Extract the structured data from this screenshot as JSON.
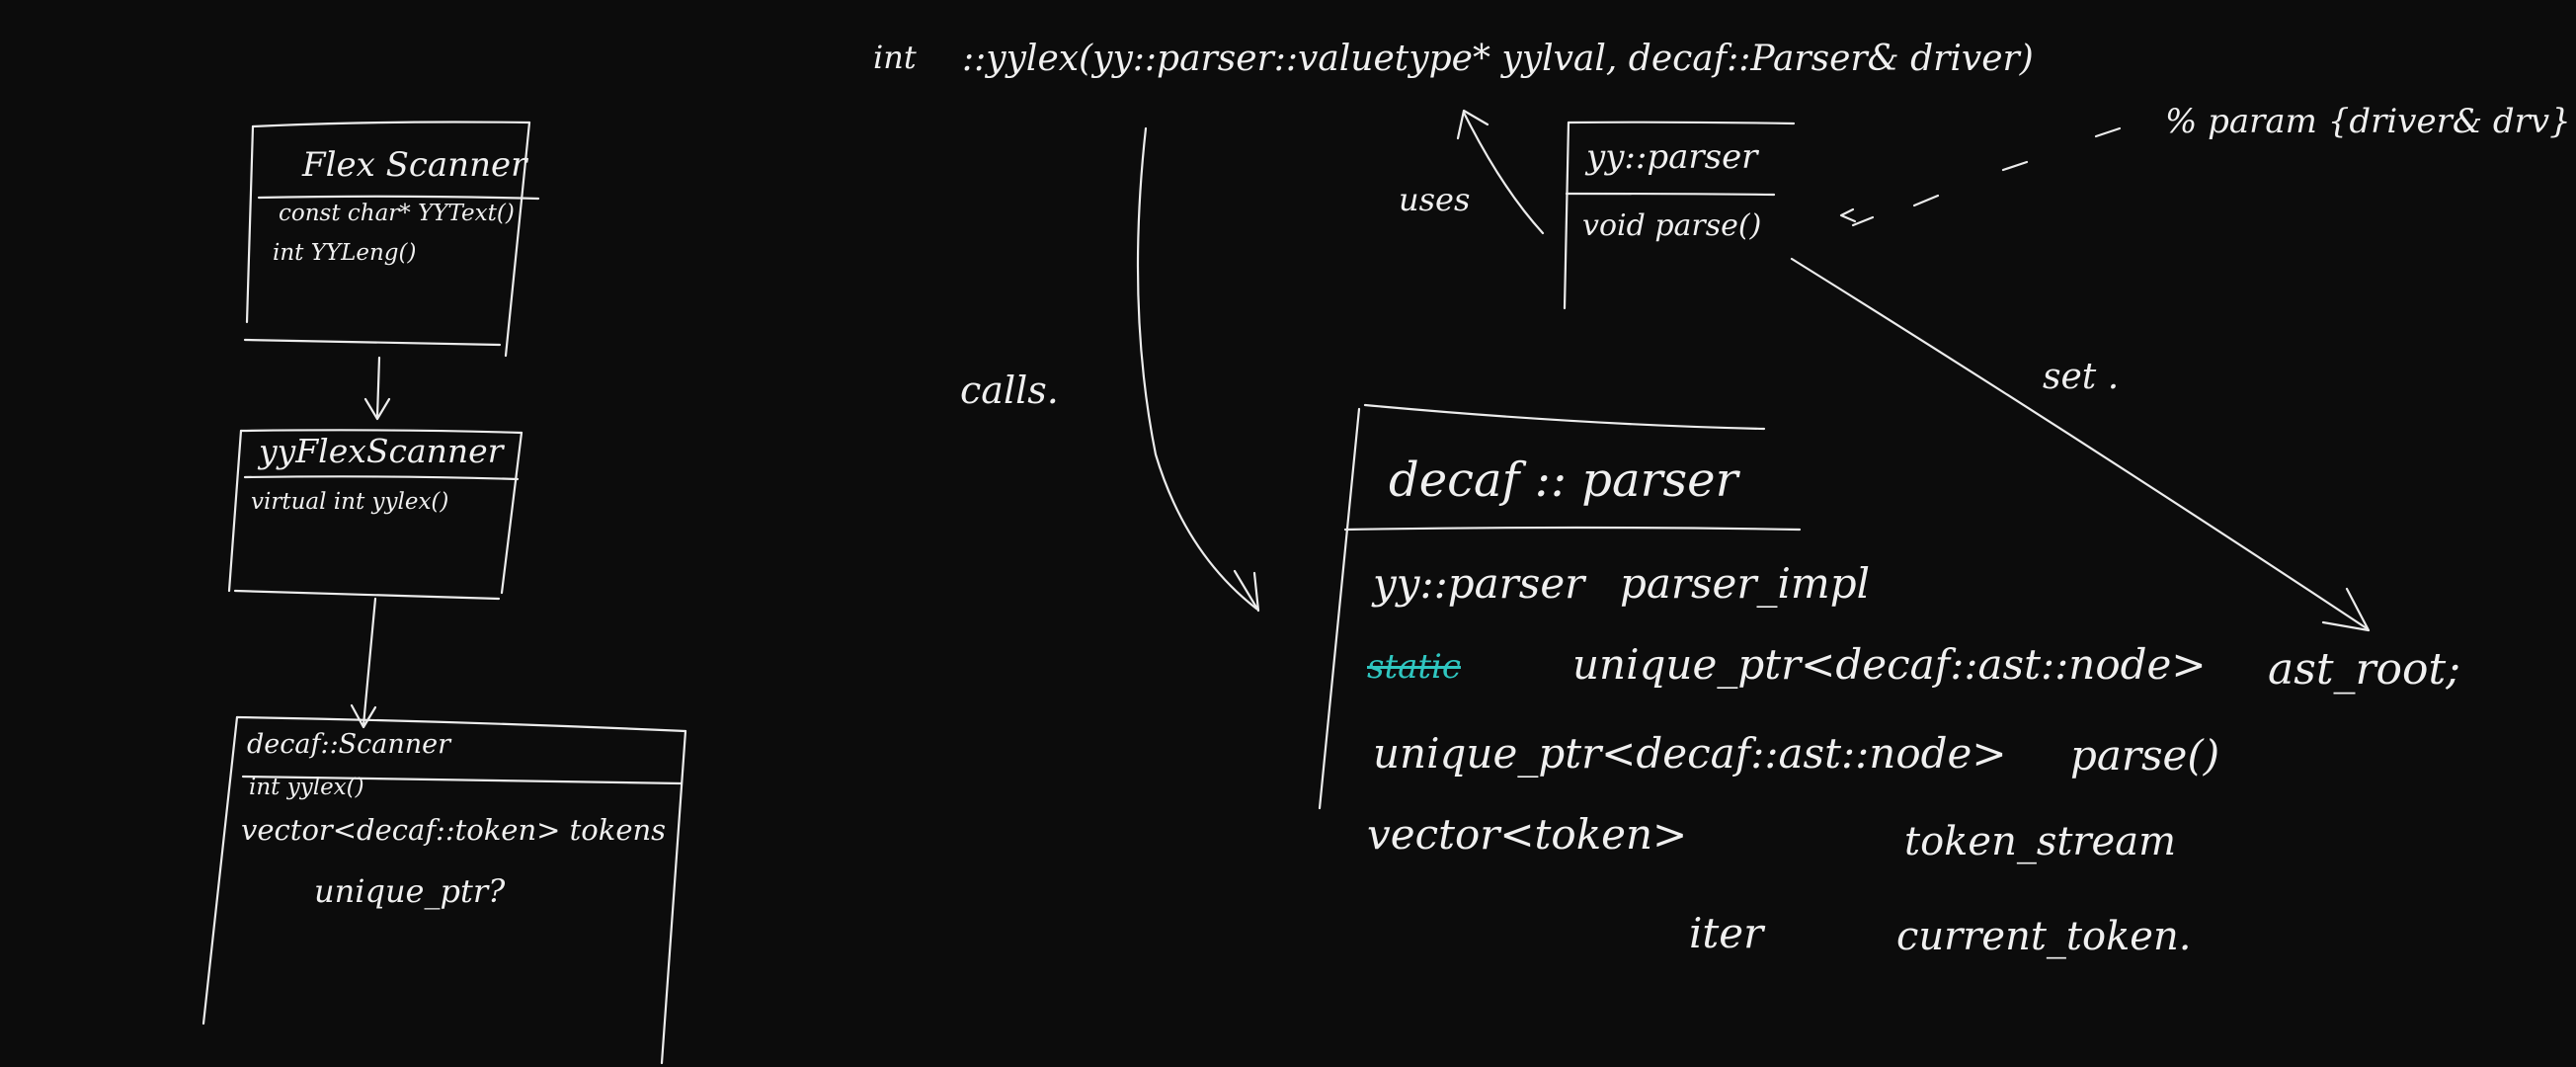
{
  "colors": {
    "background": "#0c0c0c",
    "ink": "#ececec",
    "highlight": "#2fc6c0"
  },
  "signature": {
    "ret": "int",
    "text": "::yylex(yy::parser::valuetype* yylval, decaf::Parser& driver)"
  },
  "flex_scanner": {
    "title": "Flex Scanner",
    "members": [
      "const char* YYText()",
      "int YYLeng()"
    ]
  },
  "yy_flex_scanner": {
    "title": "yyFlexScanner",
    "members": [
      "virtual int yylex()"
    ]
  },
  "decaf_scanner": {
    "title": "decaf::Scanner",
    "members": [
      "int yylex()",
      "vector<decaf::token>  tokens",
      "unique_ptr?"
    ]
  },
  "yy_parser": {
    "title": "yy::parser",
    "members": [
      "void parse()"
    ]
  },
  "param_note": "% param {driver& drv}",
  "labels": {
    "uses": "uses",
    "calls": "calls.",
    "set": "set ."
  },
  "decaf_parser": {
    "title": "decaf :: parser",
    "rows": [
      {
        "type": "yy::parser",
        "name": "parser_impl"
      },
      {
        "modifier": "static",
        "type": "unique_ptr<decaf::ast::node>",
        "name": "ast_root;"
      },
      {
        "type": "unique_ptr<decaf::ast::node>",
        "name": "parse()"
      },
      {
        "type": "vector<token>",
        "name": "token_stream"
      },
      {
        "type": "iter",
        "name": "current_token."
      }
    ]
  }
}
